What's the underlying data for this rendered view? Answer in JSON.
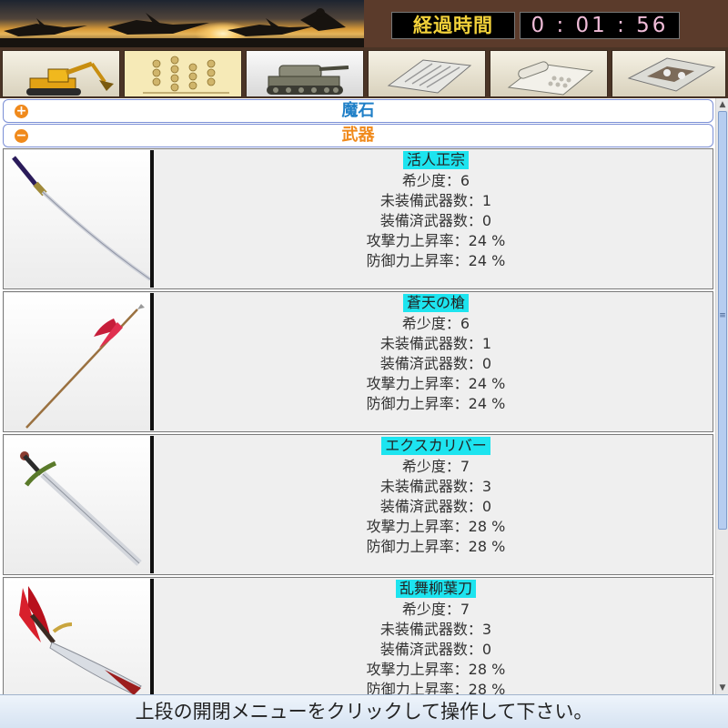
{
  "header": {
    "timer_label": "経過時間",
    "timer_value": "0 : 01 : 56"
  },
  "toolbar": {
    "items": [
      {
        "icon": "excavator-icon",
        "selected": false
      },
      {
        "icon": "abacus-icon",
        "selected": false
      },
      {
        "icon": "tank-icon",
        "selected": true
      },
      {
        "icon": "newspaper-icon",
        "selected": false
      },
      {
        "icon": "telephone-icon",
        "selected": false
      },
      {
        "icon": "cassette-tape-icon",
        "selected": false
      }
    ]
  },
  "sections": [
    {
      "toggle": "+",
      "title": "魔石",
      "color": "#1f7fc7",
      "expanded": false
    },
    {
      "toggle": "−",
      "title": "武器",
      "color": "#f08a1c",
      "expanded": true
    }
  ],
  "weapons": [
    {
      "name": "活人正宗",
      "icon": "katana-icon",
      "stats": [
        "希少度：6",
        "未装備武器数：1",
        "装備済武器数：0",
        "攻撃力上昇率：24 %",
        "防御力上昇率：24 %"
      ]
    },
    {
      "name": "蒼天の槍",
      "icon": "spear-icon",
      "stats": [
        "希少度：6",
        "未装備武器数：1",
        "装備済武器数：0",
        "攻撃力上昇率：24 %",
        "防御力上昇率：24 %"
      ]
    },
    {
      "name": "エクスカリバー",
      "icon": "longsword-icon",
      "stats": [
        "希少度：7",
        "未装備武器数：3",
        "装備済武器数：0",
        "攻撃力上昇率：28 %",
        "防御力上昇率：28 %"
      ]
    },
    {
      "name": "乱舞柳葉刀",
      "icon": "saber-icon",
      "stats": [
        "希少度：7",
        "未装備武器数：3",
        "装備済武器数：0",
        "攻撃力上昇率：28 %",
        "防御力上昇率：28 %"
      ]
    }
  ],
  "footer": {
    "message": "上段の開閉メニューをクリックして操作して下さい。"
  },
  "colors": {
    "name_highlight": "#1de4ef",
    "timer_label": "#f3d23a",
    "timer_value": "#f0bcd8",
    "accent_orange": "#f08a1c",
    "accent_blue": "#1f7fc7"
  }
}
